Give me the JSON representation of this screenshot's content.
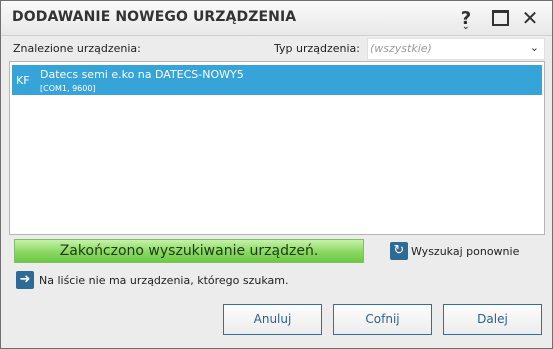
{
  "dialog": {
    "title": "DODAWANIE NOWEGO URZĄDZENIA",
    "help_label": "?",
    "close_label": "✕"
  },
  "found_devices_label": "Znalezione urządzenia:",
  "device_type": {
    "label": "Typ urządzenia:",
    "value": "(wszystkie)"
  },
  "devices": [
    {
      "tag": "KF",
      "name": "Datecs semi e.ko  na  DATECS-NOWY5",
      "port": "[COM1, 9600]",
      "selected": true
    }
  ],
  "status": {
    "text": "Zakończono wyszukiwanie urządzeń.",
    "progress": 1.0
  },
  "rescan_label": "Wyszukaj ponownie",
  "not_listed_label": "Na liście nie ma urządzenia, którego szukam.",
  "buttons": {
    "cancel": "Anuluj",
    "back": "Cofnij",
    "next": "Dalej"
  },
  "colors": {
    "selection": "#36a3d9",
    "progress_fill": "#8ad862",
    "button_border": "#2e6fa8",
    "icon_bg": "#2f6a96"
  }
}
